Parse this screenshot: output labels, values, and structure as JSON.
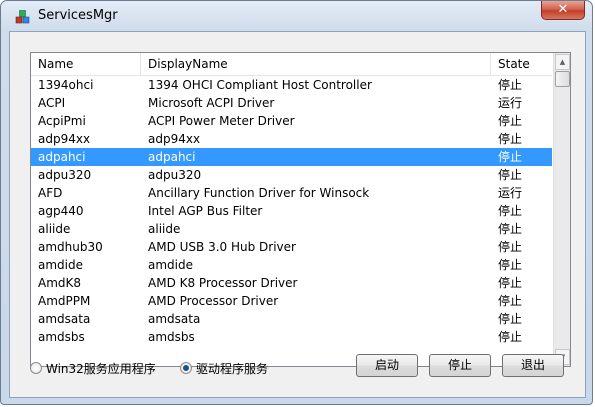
{
  "window": {
    "title": "ServicesMgr",
    "close_glyph": "✕",
    "icon": "services-app-icon"
  },
  "listview": {
    "columns": [
      "Name",
      "DisplayName",
      "State"
    ],
    "rows": [
      {
        "name": "1394ohci",
        "display": "1394 OHCI Compliant Host Controller",
        "state": "停止"
      },
      {
        "name": "ACPI",
        "display": "Microsoft ACPI Driver",
        "state": "运行"
      },
      {
        "name": "AcpiPmi",
        "display": "ACPI Power Meter Driver",
        "state": "停止"
      },
      {
        "name": "adp94xx",
        "display": "adp94xx",
        "state": "停止"
      },
      {
        "name": "adpahci",
        "display": "adpahci",
        "state": "停止"
      },
      {
        "name": "adpu320",
        "display": "adpu320",
        "state": "停止"
      },
      {
        "name": "AFD",
        "display": "Ancillary Function Driver for Winsock",
        "state": "运行"
      },
      {
        "name": "agp440",
        "display": "Intel AGP Bus Filter",
        "state": "停止"
      },
      {
        "name": "aliide",
        "display": "aliide",
        "state": "停止"
      },
      {
        "name": "amdhub30",
        "display": "AMD USB 3.0 Hub Driver",
        "state": "停止"
      },
      {
        "name": "amdide",
        "display": "amdide",
        "state": "停止"
      },
      {
        "name": "AmdK8",
        "display": "AMD K8 Processor Driver",
        "state": "停止"
      },
      {
        "name": "AmdPPM",
        "display": "AMD Processor Driver",
        "state": "停止"
      },
      {
        "name": "amdsata",
        "display": "amdsata",
        "state": "停止"
      },
      {
        "name": "amdsbs",
        "display": "amdsbs",
        "state": "停止"
      }
    ],
    "selected_index": 4,
    "selection_color": "#3399ff"
  },
  "options": {
    "win32_label": "Win32服务应用程序",
    "driver_label": "驱动程序服务",
    "selected": "driver"
  },
  "buttons": {
    "start": "启动",
    "stop": "停止",
    "exit": "退出"
  }
}
